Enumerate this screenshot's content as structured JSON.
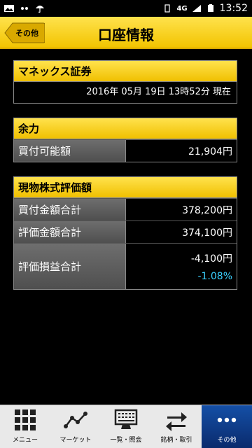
{
  "statusbar": {
    "network": "4G",
    "time": "13:52"
  },
  "header": {
    "back_label": "その他",
    "title": "口座情報"
  },
  "monex": {
    "heading": "マネックス証券",
    "datetime": "2016年 05月 19日 13時52分 現在"
  },
  "yoryoku": {
    "heading": "余力",
    "rows": [
      {
        "label": "買付可能額",
        "value": "21,904円"
      }
    ]
  },
  "genbutsu": {
    "heading": "現物株式評価額",
    "rows": [
      {
        "label": "買付金額合計",
        "value": "378,200円"
      },
      {
        "label": "評価金額合計",
        "value": "374,100円"
      }
    ],
    "pl": {
      "label": "評価損益合計",
      "value": "-4,100円",
      "percent": "-1.08%"
    }
  },
  "bottomnav": {
    "items": [
      {
        "label": "メニュー",
        "icon": "grid-icon"
      },
      {
        "label": "マーケット",
        "icon": "chart-icon"
      },
      {
        "label": "一覧・照会",
        "icon": "monitor-icon"
      },
      {
        "label": "銘柄・取引",
        "icon": "exchange-icon"
      },
      {
        "label": "その他",
        "icon": "more-icon"
      }
    ]
  },
  "colors": {
    "header_yellow": "#f2c400",
    "percent_blue": "#3ad0ff",
    "nav_active": "#144fa6"
  }
}
